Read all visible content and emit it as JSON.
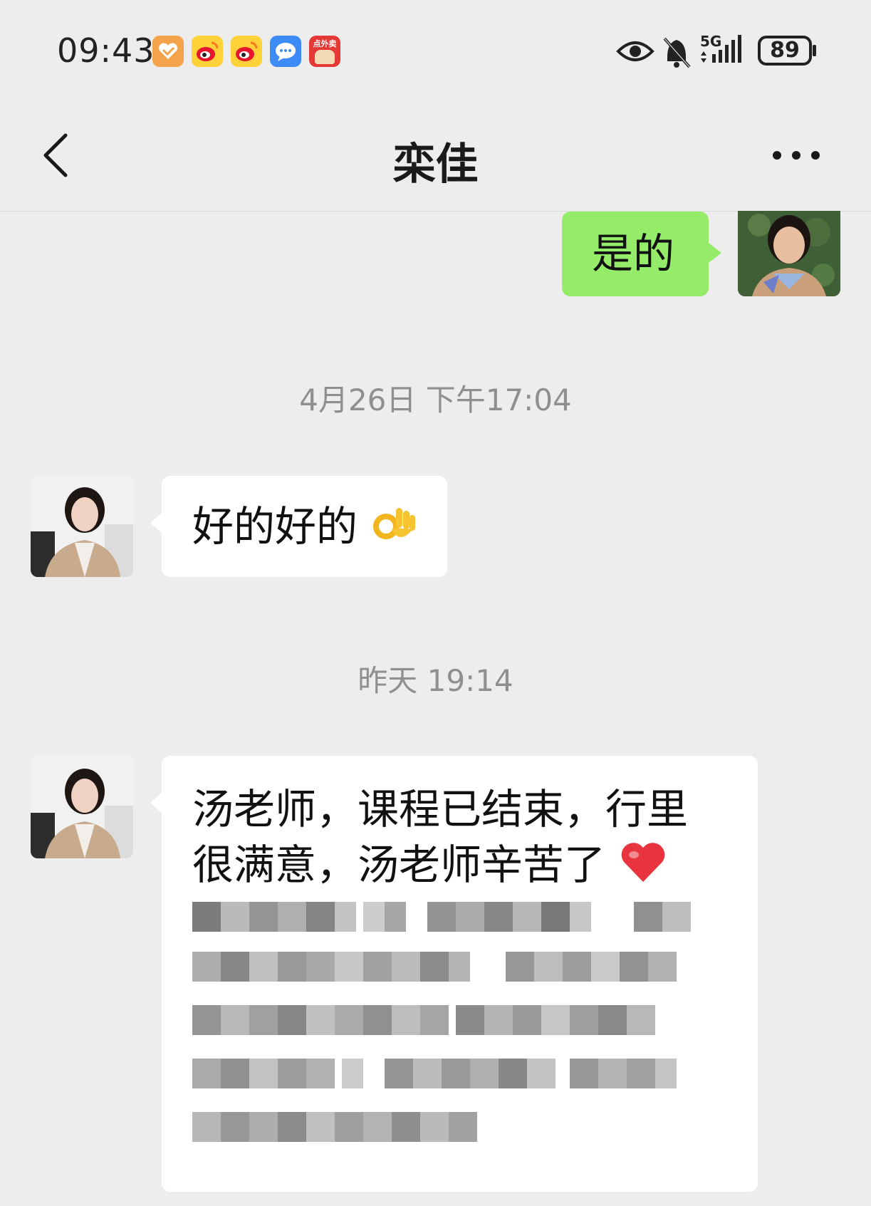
{
  "status_bar": {
    "time": "09:43",
    "notification_icons": [
      "heart-app-icon",
      "weibo-icon",
      "weibo-icon",
      "messages-icon",
      "food-delivery-icon"
    ],
    "food_delivery_label": "点外卖",
    "network_label": "5G",
    "battery_level": "89"
  },
  "nav": {
    "title": "栾佳"
  },
  "messages": [
    {
      "from": "me",
      "text": "是的"
    },
    {
      "timestamp": "4月26日 下午17:04"
    },
    {
      "from": "contact",
      "text": "好的好的",
      "emoji": "ok-hand-emoji"
    },
    {
      "timestamp": "昨天 19:14"
    },
    {
      "from": "contact",
      "text_line1": "汤老师，课程已结束，行里",
      "text_line2": "很满意，汤老师辛苦了",
      "emoji": "red-heart-emoji",
      "redacted_lines": 5
    }
  ],
  "colors": {
    "background": "#ededed",
    "my_bubble": "#95ec69",
    "contact_bubble": "#ffffff",
    "timestamp": "#8f8f8f"
  }
}
